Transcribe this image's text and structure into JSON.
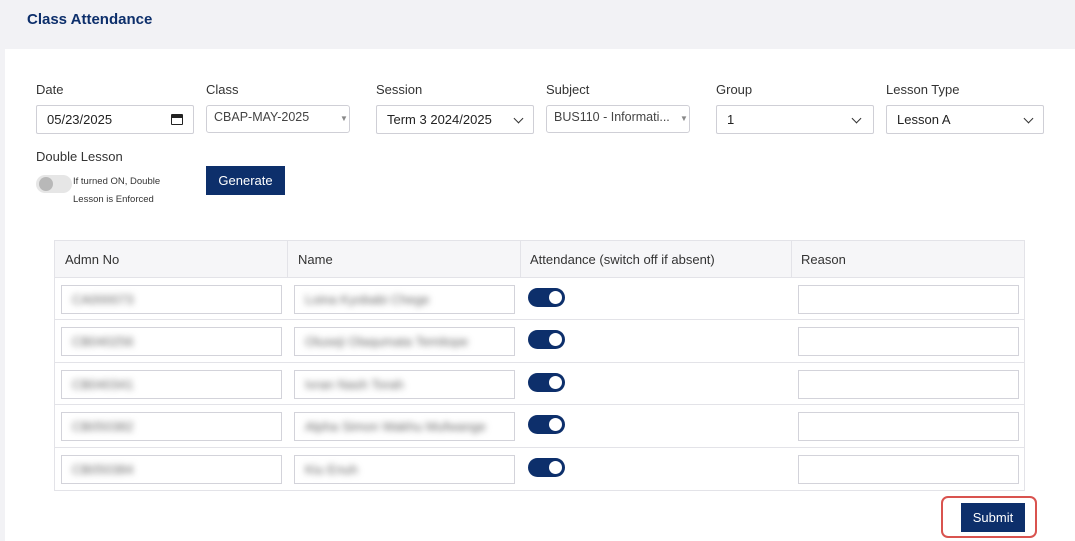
{
  "page": {
    "title": "Class Attendance"
  },
  "filters": {
    "date": {
      "label": "Date",
      "value": "05/23/2025"
    },
    "class": {
      "label": "Class",
      "value": "CBAP-MAY-2025"
    },
    "session": {
      "label": "Session",
      "value": "Term 3 2024/2025"
    },
    "subject": {
      "label": "Subject",
      "value": "BUS110 - Informati..."
    },
    "group": {
      "label": "Group",
      "value": "1"
    },
    "lesson_type": {
      "label": "Lesson Type",
      "value": "Lesson A"
    },
    "double_lesson": {
      "label": "Double Lesson",
      "enabled": false,
      "note_line1": "If turned ON, Double",
      "note_line2": "Lesson is Enforced"
    },
    "generate_label": "Generate"
  },
  "table": {
    "headers": {
      "admn_no": "Admn No",
      "name": "Name",
      "attendance": "Attendance (switch off if absent)",
      "reason": "Reason"
    },
    "rows": [
      {
        "admn_no": "CA000073",
        "name": "Loina Kyobabi Chege",
        "present": true,
        "reason": ""
      },
      {
        "admn_no": "CB040256",
        "name": "Oluseji Olaqumata Temitope",
        "present": true,
        "reason": ""
      },
      {
        "admn_no": "CB040341",
        "name": "Ivran Nash Torah",
        "present": true,
        "reason": ""
      },
      {
        "admn_no": "CB050382",
        "name": "Alpha Simon Wakhu Mufwange",
        "present": true,
        "reason": ""
      },
      {
        "admn_no": "CB050384",
        "name": "Kiu Enuh",
        "present": true,
        "reason": ""
      }
    ]
  },
  "actions": {
    "submit_label": "Submit"
  },
  "colors": {
    "primary": "#0d2f6b",
    "highlight": "#d9534f"
  }
}
